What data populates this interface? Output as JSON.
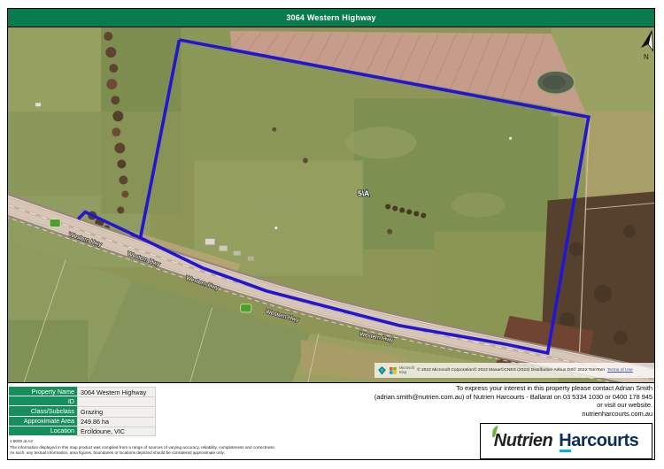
{
  "header": {
    "title": "3064 Western Highway"
  },
  "map": {
    "parcel_label": "5\\A",
    "road_label": "Western Hwy",
    "north_label": "N",
    "attribution": {
      "provider_line1": "Microsoft",
      "provider_line2": "Bing",
      "copyright": "© 2022 Microsoft Corporation© 2022 Maxar©CNES (2022) Distribution Airbus DS© 2022 TomTom",
      "terms_label": "Terms of Use"
    }
  },
  "details": {
    "rows": [
      {
        "label": "Property Name",
        "value": "3064 Western Highway"
      },
      {
        "label": "ID",
        "value": ""
      },
      {
        "label": "Class/Subclass",
        "value": "Grazing"
      },
      {
        "label": "Approximate Area",
        "value": "249.86 ha"
      },
      {
        "label": "Location",
        "value": "Ercildoune, VIC"
      }
    ]
  },
  "notes": {
    "scale": "1:8000 at A3",
    "disclaimer": "The information displayed in this map product was compiled from a range of sources of varying accuracy, reliability, completeness and correctness. As such, any textual information, area figures, boundaries or locations depicted should be considered approximate only."
  },
  "contact": {
    "line1": "To express your interest in this property please contact Adrian Smith",
    "line2": "(adrian.smith@nutrien.com.au) of Nutrien Harcourts - Ballarat on 03 5334 1030 or 0400 178 945",
    "line3": "or visit our website.",
    "line4": "nutrienharcourts.com.au"
  },
  "logo": {
    "brand_left": "Nutrien",
    "brand_right": "Harcourts"
  },
  "colors": {
    "header_green": "#0a7b4e",
    "table_green": "#15905d",
    "boundary_blue": "#2415d2",
    "harcourts_navy": "#0a2e5c",
    "cyan_underline": "#00b0f0"
  }
}
